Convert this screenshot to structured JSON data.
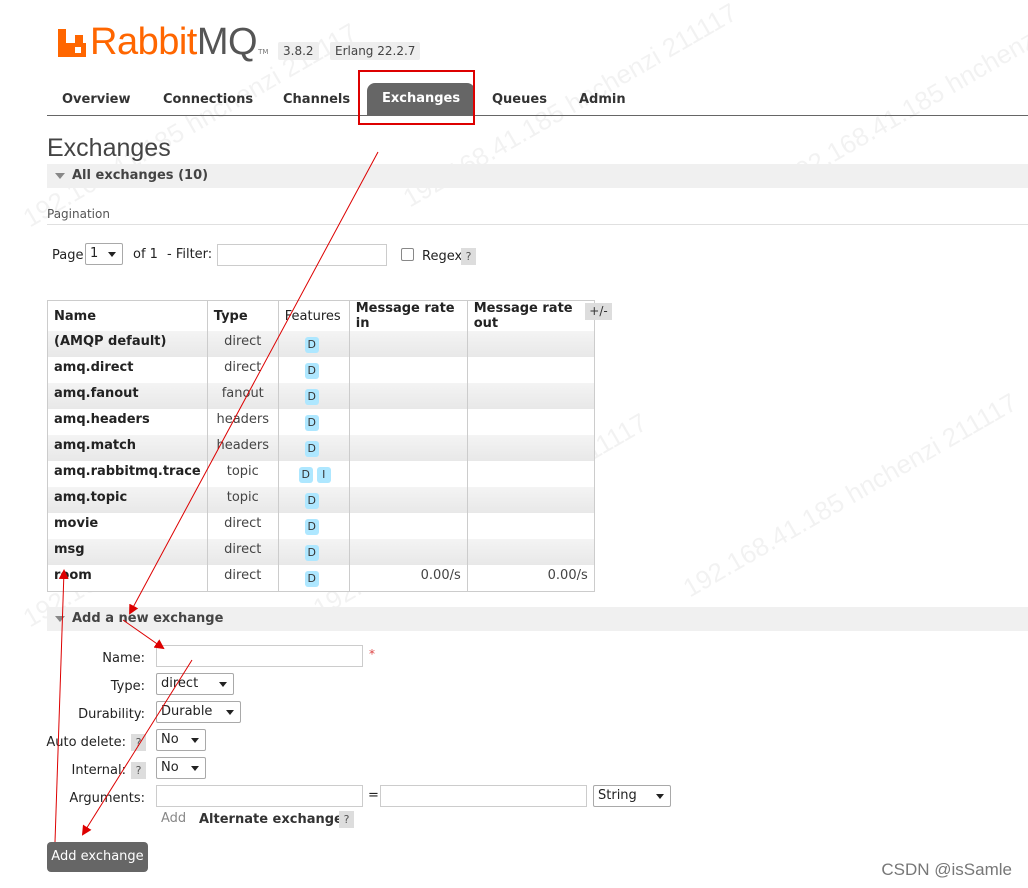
{
  "app": {
    "logo_rabbit": "Rabbit",
    "logo_mq": "MQ",
    "logo_tm": "TM",
    "version": "3.8.2",
    "erlang": "Erlang 22.2.7"
  },
  "nav": {
    "tabs": [
      {
        "label": "Overview"
      },
      {
        "label": "Connections"
      },
      {
        "label": "Channels"
      },
      {
        "label": "Exchanges",
        "active": true
      },
      {
        "label": "Queues"
      },
      {
        "label": "Admin"
      }
    ]
  },
  "page": {
    "title": "Exchanges",
    "all_exchanges": "All exchanges (10)",
    "pagination": "Pagination"
  },
  "pager": {
    "page_label": "Page",
    "page_value": "1",
    "of_label": "of 1",
    "filter_label": "- Filter:",
    "filter_value": "",
    "regex_label": "Regex",
    "help": "?"
  },
  "table": {
    "headers": [
      "Name",
      "Type",
      "Features",
      "Message rate in",
      "Message rate out"
    ],
    "toggle": "+/-",
    "rows": [
      {
        "name": "(AMQP default)",
        "type": "direct",
        "features": [
          "D"
        ],
        "rate_in": "",
        "rate_out": ""
      },
      {
        "name": "amq.direct",
        "type": "direct",
        "features": [
          "D"
        ],
        "rate_in": "",
        "rate_out": ""
      },
      {
        "name": "amq.fanout",
        "type": "fanout",
        "features": [
          "D"
        ],
        "rate_in": "",
        "rate_out": ""
      },
      {
        "name": "amq.headers",
        "type": "headers",
        "features": [
          "D"
        ],
        "rate_in": "",
        "rate_out": ""
      },
      {
        "name": "amq.match",
        "type": "headers",
        "features": [
          "D"
        ],
        "rate_in": "",
        "rate_out": ""
      },
      {
        "name": "amq.rabbitmq.trace",
        "type": "topic",
        "features": [
          "D",
          "I"
        ],
        "rate_in": "",
        "rate_out": ""
      },
      {
        "name": "amq.topic",
        "type": "topic",
        "features": [
          "D"
        ],
        "rate_in": "",
        "rate_out": ""
      },
      {
        "name": "movie",
        "type": "direct",
        "features": [
          "D"
        ],
        "rate_in": "",
        "rate_out": ""
      },
      {
        "name": "msg",
        "type": "direct",
        "features": [
          "D"
        ],
        "rate_in": "",
        "rate_out": ""
      },
      {
        "name": "room",
        "type": "direct",
        "features": [
          "D"
        ],
        "rate_in": "0.00/s",
        "rate_out": "0.00/s"
      }
    ]
  },
  "add": {
    "section": "Add a new exchange",
    "name_label": "Name:",
    "name_value": "",
    "required": "*",
    "type_label": "Type:",
    "type_value": "direct",
    "durability_label": "Durability:",
    "durability_value": "Durable",
    "autodelete_label": "Auto delete:",
    "autodelete_value": "No",
    "internal_label": "Internal:",
    "internal_value": "No",
    "arguments_label": "Arguments:",
    "arg_key": "",
    "equals": "=",
    "arg_value": "",
    "arg_type": "String",
    "add_link": "Add",
    "alternate": "Alternate exchange",
    "help": "?",
    "submit": "Add exchange"
  },
  "watermarks": {
    "csdn": "CSDN @isSamle",
    "ip": "192.168.41.185 hnchenzi 211117"
  },
  "colors": {
    "brand": "#ff6600",
    "tab_active": "#666666",
    "badge": "#aee7ff",
    "annotation": "#dd0000"
  }
}
